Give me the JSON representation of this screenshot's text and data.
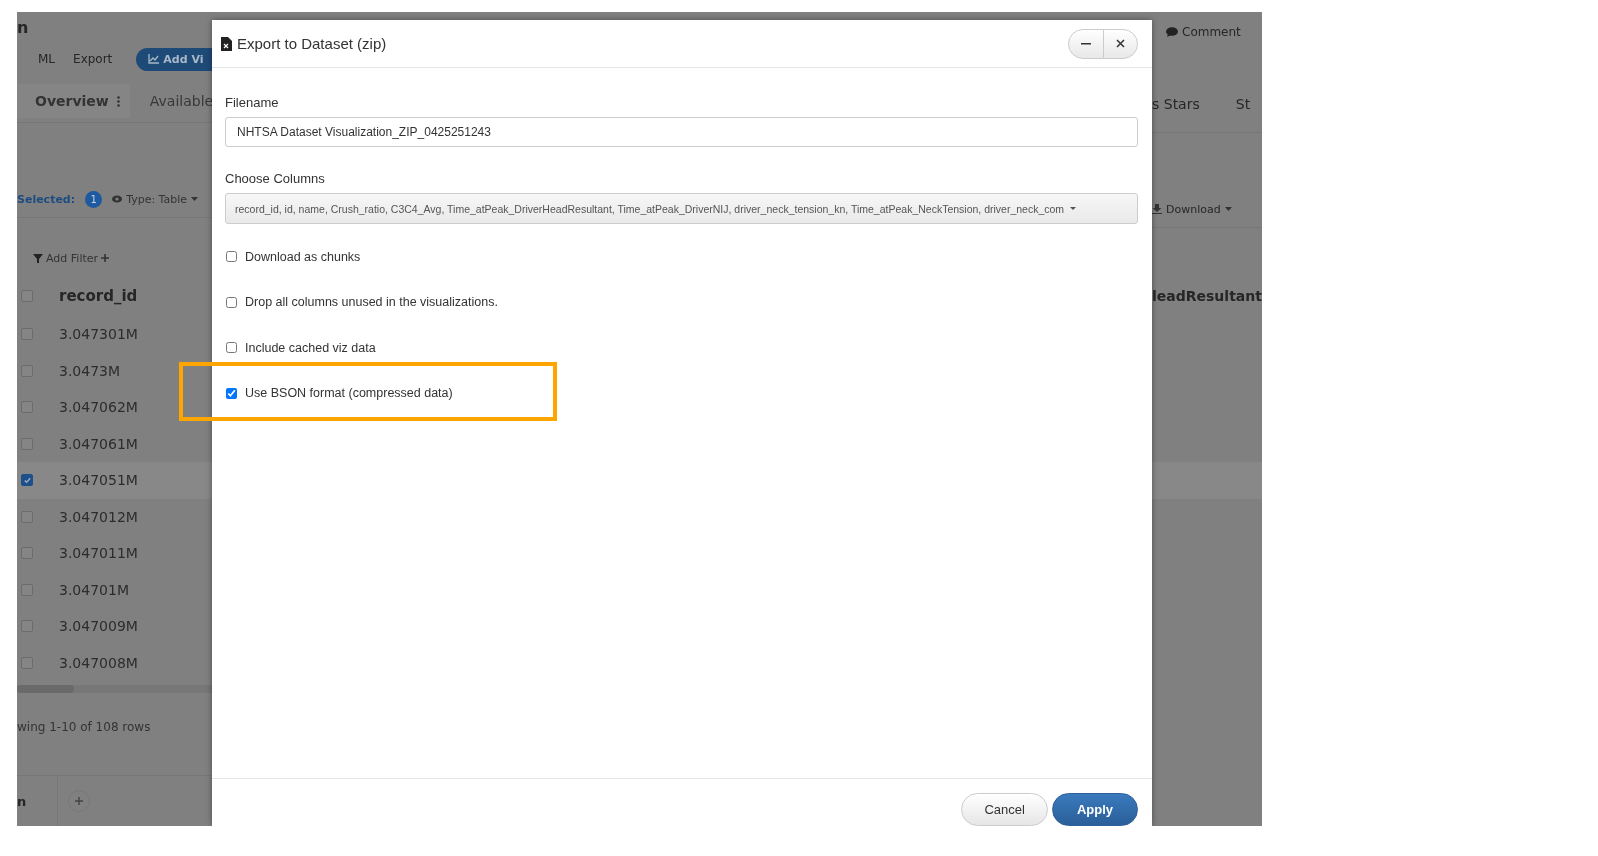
{
  "background": {
    "app_title": "n",
    "menu": [
      {
        "label": "ML"
      },
      {
        "label": "Export"
      }
    ],
    "add_button": "Add Vi",
    "tabs": [
      {
        "label": "Overview",
        "selected": true
      },
      {
        "label": "Available",
        "selected": false
      }
    ],
    "comment": "Comment",
    "right_tabs": [
      "s Stars",
      "St"
    ],
    "selected_label": "Selected:",
    "selected_count": "1",
    "type_menu": "Type: Table",
    "download_menu": "Download",
    "add_filter": "Add Filter",
    "columns": [
      "record_id",
      "leadResultant"
    ],
    "header_checked": false,
    "rows": [
      {
        "record_id": "3.047301M",
        "checked": false
      },
      {
        "record_id": "3.0473M",
        "checked": false
      },
      {
        "record_id": "3.047062M",
        "checked": false
      },
      {
        "record_id": "3.047061M",
        "checked": false
      },
      {
        "record_id": "3.047051M",
        "checked": true
      },
      {
        "record_id": "3.047012M",
        "checked": false
      },
      {
        "record_id": "3.047011M",
        "checked": false
      },
      {
        "record_id": "3.04701M",
        "checked": false
      },
      {
        "record_id": "3.047009M",
        "checked": false
      },
      {
        "record_id": "3.047008M",
        "checked": false
      }
    ],
    "footer": "wing 1-10 of 108 rows",
    "sheet_tab": "n"
  },
  "dialog": {
    "title": "Export to Dataset (zip)",
    "filename_label": "Filename",
    "filename_value": "NHTSA Dataset Visualization_ZIP_0425251243",
    "columns_label": "Choose Columns",
    "columns_value": "record_id, id, name, Crush_ratio, C3C4_Avg, Time_atPeak_DriverHeadResultant, Time_atPeak_DriverNIJ, driver_neck_tension_kn, Time_atPeak_NeckTension, driver_neck_com",
    "options": [
      {
        "label": "Download as chunks",
        "checked": false,
        "highlighted": false
      },
      {
        "label": "Drop all columns unused in the visualizations.",
        "checked": false,
        "highlighted": false
      },
      {
        "label": "Include cached viz data",
        "checked": false,
        "highlighted": false
      },
      {
        "label": "Use BSON format (compressed data)",
        "checked": true,
        "highlighted": true
      }
    ],
    "buttons": [
      {
        "label": "Cancel",
        "kind": "secondary"
      },
      {
        "label": "Apply",
        "kind": "primary"
      }
    ]
  }
}
